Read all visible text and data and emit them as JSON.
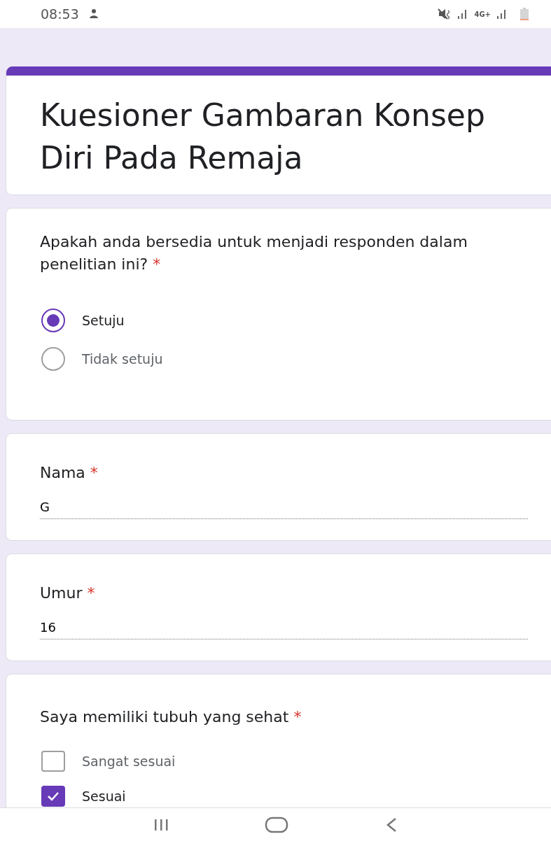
{
  "status_bar": {
    "time": "08:53",
    "network_type": "4G+"
  },
  "form": {
    "title": "Kuesioner Gambaran Konsep Diri Pada Remaja",
    "questions": [
      {
        "kind": "radio",
        "label": "Apakah anda bersedia untuk menjadi responden dalam penelitian ini?",
        "required_mark": "*",
        "options": [
          {
            "label": "Setuju",
            "selected": true
          },
          {
            "label": "Tidak setuju",
            "selected": false
          }
        ]
      },
      {
        "kind": "text",
        "label": "Nama",
        "required_mark": "*",
        "value": "G"
      },
      {
        "kind": "text",
        "label": "Umur",
        "required_mark": "*",
        "value": "16"
      },
      {
        "kind": "checkbox",
        "label": "Saya memiliki tubuh yang sehat",
        "required_mark": "*",
        "options": [
          {
            "label": "Sangat sesuai",
            "checked": false
          },
          {
            "label": "Sesuai",
            "checked": true
          }
        ]
      }
    ]
  }
}
